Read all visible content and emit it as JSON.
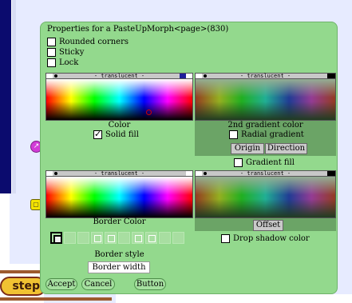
{
  "dialog": {
    "title": "Properties for a PasteUpMorph<page>(830)",
    "checkboxes": [
      {
        "label": "Rounded corners",
        "checked": false
      },
      {
        "label": "Sticky",
        "checked": false
      },
      {
        "label": "Lock",
        "checked": false
      }
    ],
    "translucent_label": "- translucent -",
    "color_label": "Color",
    "solid_fill_label": "Solid fill",
    "solid_fill_checked": true,
    "gradient_color_label": "2nd gradient color",
    "radial_gradient_label": "Radial gradient",
    "origin_label": "Origin",
    "direction_label": "Direction",
    "gradient_fill_label": "Gradient fill",
    "border_color_label": "Border Color",
    "offset_label": "Offset",
    "drop_shadow_label": "Drop shadow color",
    "border_style_label": "Border style",
    "border_width_label": "Border width",
    "accept_label": "Accept",
    "cancel_label": "Cancel",
    "button_label": "Button"
  },
  "world": {
    "step_label": "step"
  },
  "colors": {
    "dialog_bg": "#93d98d",
    "navy": "#0b0b6e",
    "step_yellow": "#f1c232",
    "halo_pink": "#d23bd8",
    "halo_yellow": "#f4e300"
  }
}
